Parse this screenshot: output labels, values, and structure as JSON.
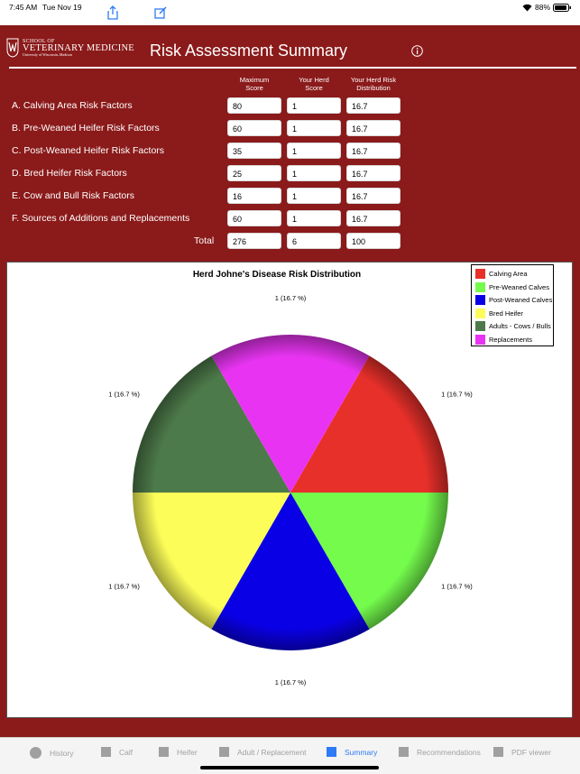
{
  "status": {
    "time": "7:45 AM",
    "date": "Tue Nov 19",
    "battery": "88%"
  },
  "header": {
    "logo_school": "SCHOOL OF",
    "logo_vet": "VETERINARY MEDICINE",
    "logo_uw": "University of Wisconsin–Madison",
    "title": "Risk Assessment Summary"
  },
  "table": {
    "headers": {
      "max": [
        "Maximum",
        "Score"
      ],
      "herd": [
        "Your Herd",
        "Score"
      ],
      "dist": [
        "Your Herd Risk",
        "Distribution"
      ]
    },
    "rows": [
      {
        "label": "A. Calving Area Risk Factors",
        "max": "80",
        "herd": "1",
        "dist": "16.7"
      },
      {
        "label": "B. Pre-Weaned Heifer Risk Factors",
        "max": "60",
        "herd": "1",
        "dist": "16.7"
      },
      {
        "label": "C. Post-Weaned Heifer Risk Factors",
        "max": "35",
        "herd": "1",
        "dist": "16.7"
      },
      {
        "label": "D. Bred Heifer Risk Factors",
        "max": "25",
        "herd": "1",
        "dist": "16.7"
      },
      {
        "label": "E. Cow and Bull Risk Factors",
        "max": "16",
        "herd": "1",
        "dist": "16.7"
      },
      {
        "label": "F. Sources of Additions and Replacements",
        "max": "60",
        "herd": "1",
        "dist": "16.7"
      }
    ],
    "total": {
      "label": "Total",
      "max": "276",
      "herd": "6",
      "dist": "100"
    }
  },
  "chart_data": {
    "type": "pie",
    "title": "Herd Johne's Disease Risk Distribution",
    "legend_position": "top-right",
    "slices": [
      {
        "name": "Calving Area",
        "value": 1,
        "label": "1 (16.7 %)",
        "color": "#e8302a"
      },
      {
        "name": "Pre-Weaned Calves",
        "value": 1,
        "label": "1 (16.7 %)",
        "color": "#74fb4c"
      },
      {
        "name": "Post-Weaned Calves",
        "value": 1,
        "label": "1 (16.7 %)",
        "color": "#0a00e6"
      },
      {
        "name": "Bred Heifer",
        "value": 1,
        "label": "1 (16.7 %)",
        "color": "#fcfd58"
      },
      {
        "name": "Adults - Cows / Bulls",
        "value": 1,
        "label": "1 (16.7 %)",
        "color": "#4d7a4a"
      },
      {
        "name": "Replacements",
        "value": 1,
        "label": "1 (16.7 %)",
        "color": "#e834f2"
      }
    ]
  },
  "tabs": [
    {
      "label": "History",
      "icon": "circle-icon",
      "active": false
    },
    {
      "label": "Calf",
      "icon": "square-icon",
      "active": false
    },
    {
      "label": "Heifer",
      "icon": "square-icon",
      "active": false
    },
    {
      "label": "Adult / Replacement",
      "icon": "square-icon",
      "active": false
    },
    {
      "label": "Summary",
      "icon": "square-icon",
      "active": true
    },
    {
      "label": "Recommendations",
      "icon": "square-icon",
      "active": false
    },
    {
      "label": "PDF viewer",
      "icon": "square-icon",
      "active": false
    }
  ],
  "colors": {
    "brand": "#8b1a1a",
    "active_tab": "#2f7bf5"
  }
}
